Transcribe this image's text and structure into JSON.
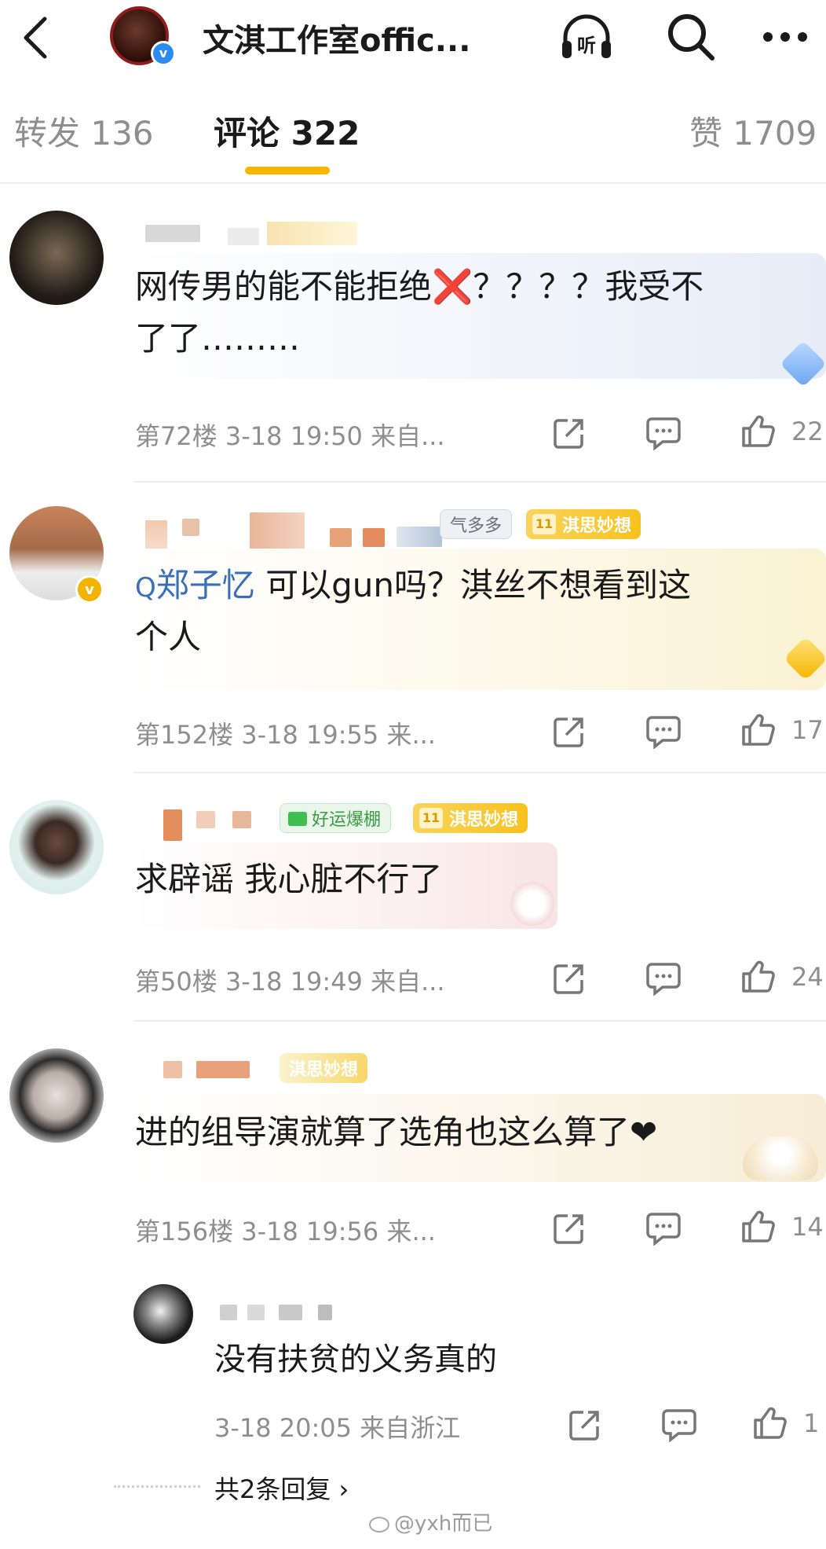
{
  "header": {
    "title": "文淇工作室offic...",
    "listen_label": "听"
  },
  "tabs": {
    "repost": "转发 136",
    "comments": "评论 322",
    "likes": "赞 1709"
  },
  "comments": [
    {
      "text_line1": "网传男的能不能拒绝❌？？？？我受不",
      "text_line2": "了了………",
      "meta": "第72楼 3-18 19:50 来自...",
      "likes": "22"
    },
    {
      "badge1": "气多多",
      "badge2": "淇思妙想",
      "badge2_level": "11",
      "search_term": "郑子忆",
      "text_line1_rest": "可以gun吗？淇丝不想看到这",
      "text_line2": "个人",
      "meta": "第152楼 3-18 19:55 来...",
      "likes": "17"
    },
    {
      "badge1": "好运爆棚",
      "badge2": "淇思妙想",
      "badge2_level": "11",
      "text_line1": "求辟谣 我心脏不行了",
      "meta": "第50楼 3-18 19:49 来自...",
      "likes": "24"
    },
    {
      "badge1": "淇思妙想",
      "text_line1": "进的组导演就算了选角也这么算了❤",
      "meta": "第156楼 3-18 19:56 来...",
      "likes": "14"
    }
  ],
  "reply": {
    "text": "没有扶贫的义务真的",
    "meta": "3-18 20:05 来自浙江",
    "likes": "1",
    "more_replies": "共2条回复 ›"
  },
  "watermark": "@yxh而已",
  "colors": {
    "accent": "#f7b500",
    "verified": "#2a8cf0",
    "meta_gray": "#8e8e8e"
  }
}
